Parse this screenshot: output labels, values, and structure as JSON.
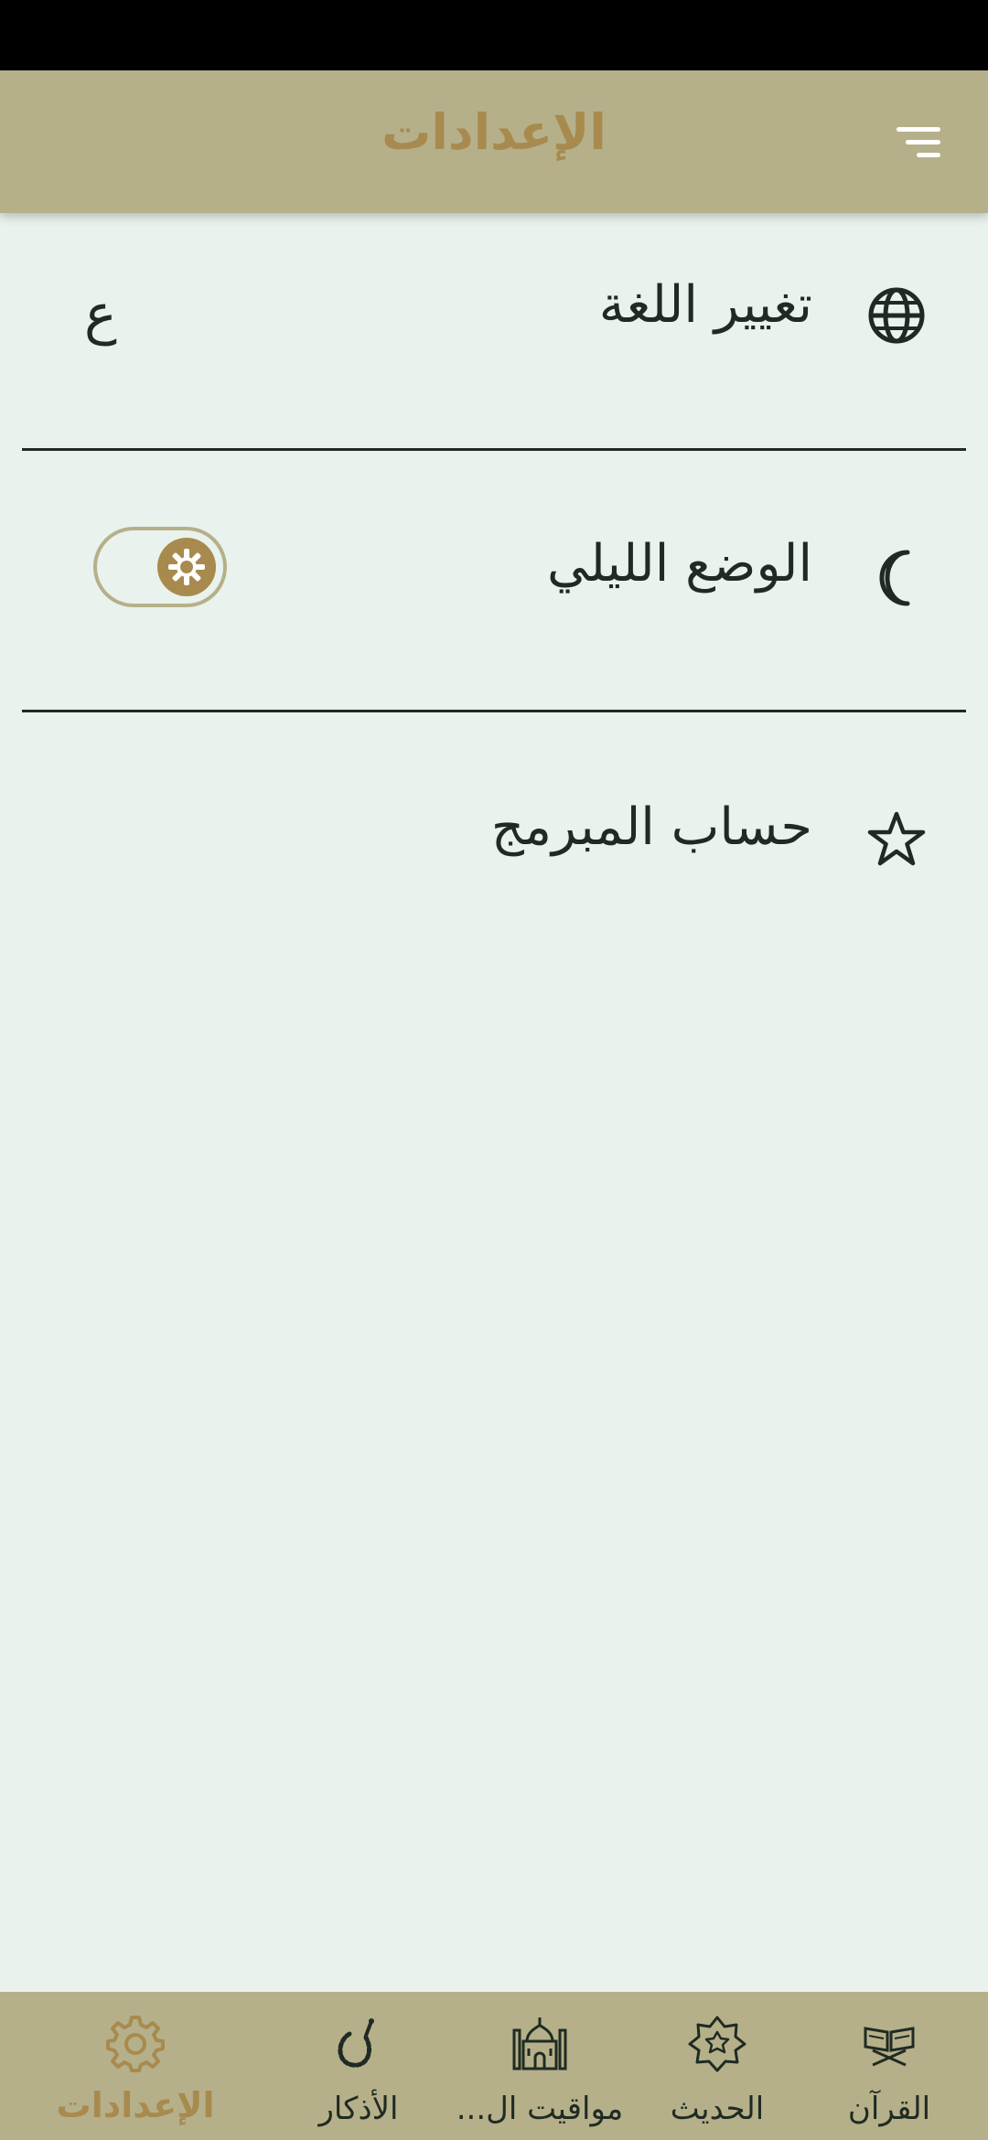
{
  "header": {
    "title": "الإعدادات"
  },
  "settings": {
    "language": {
      "label": "تغيير اللغة",
      "value": "ع"
    },
    "night_mode": {
      "label": "الوضع الليلي",
      "enabled": false
    },
    "developer": {
      "label": "حساب المبرمج"
    }
  },
  "bottom_nav": {
    "items": [
      {
        "label": "القرآن",
        "icon": "quran-icon"
      },
      {
        "label": "الحديث",
        "icon": "hadith-icon"
      },
      {
        "label": "مواقيت ال...",
        "icon": "mosque-icon"
      },
      {
        "label": "الأذكار",
        "icon": "prayer-beads-icon"
      },
      {
        "label": "الإعدادات",
        "icon": "gear-icon",
        "active": true
      }
    ]
  },
  "colors": {
    "accent": "#a88a4e",
    "bar": "#b5b08a",
    "background": "#e9f2ec",
    "text": "#1f2b22"
  }
}
